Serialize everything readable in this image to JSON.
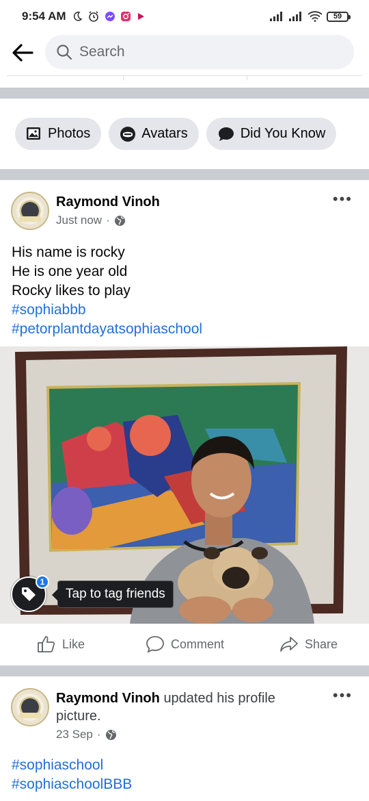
{
  "status_bar": {
    "time": "9:54 AM",
    "battery": "59",
    "left_icons": [
      "moon-icon",
      "alarm-icon",
      "messenger-icon",
      "instagram-icon",
      "youtube-icon"
    ],
    "right_icons": [
      "signal-icon",
      "signal-icon",
      "wifi-icon",
      "battery-icon"
    ]
  },
  "search": {
    "placeholder": "Search"
  },
  "chips": [
    {
      "label": "Photos",
      "icon": "photos-icon"
    },
    {
      "label": "Avatars",
      "icon": "avatar-icon"
    },
    {
      "label": "Did You Know",
      "icon": "speech-bubble-icon"
    }
  ],
  "post1": {
    "author": "Raymond Vinoh",
    "time": "Just now",
    "privacy": "globe-icon",
    "lines": [
      "His name is rocky",
      "He is one year old",
      "Rocky likes to play"
    ],
    "hashtags": [
      "#sophiabbb",
      "#petorplantdayatsophiaschool"
    ],
    "tag_count": "1",
    "tag_tooltip": "Tap to tag friends",
    "actions": {
      "like": "Like",
      "comment": "Comment",
      "share": "Share"
    }
  },
  "post2": {
    "author": "Raymond Vinoh",
    "action_text": "updated his profile",
    "action_text_2": "picture.",
    "time": "23 Sep",
    "privacy": "globe-icon",
    "hashtags": [
      "#sophiaschool",
      "#sophiaschoolBBB"
    ]
  },
  "colors": {
    "link": "#216fdb",
    "separator": "#c9ccd1",
    "chip_bg": "#e4e6eb",
    "accent": "#1877f2"
  }
}
